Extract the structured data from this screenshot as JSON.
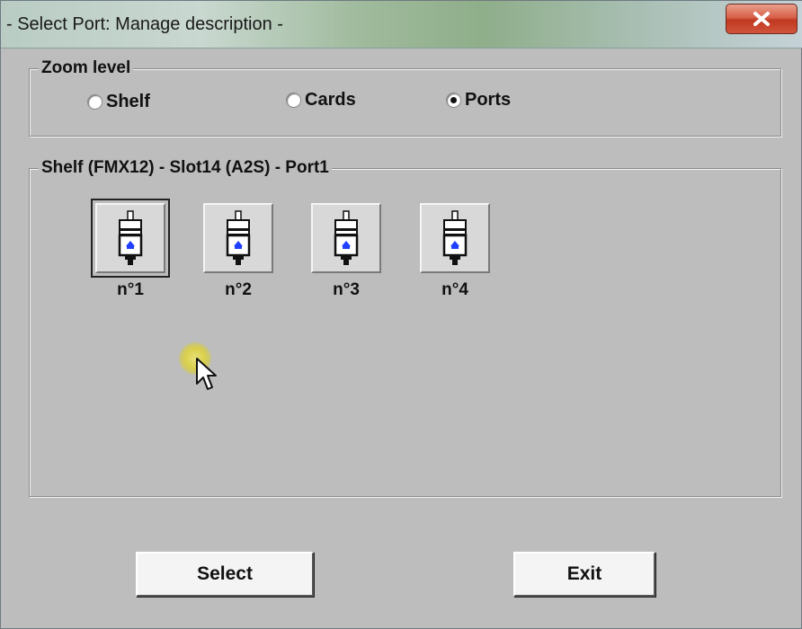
{
  "window": {
    "title": "- Select Port: Manage description -",
    "close_icon": "close-icon"
  },
  "zoom": {
    "legend": "Zoom level",
    "options": [
      {
        "label": "Shelf",
        "checked": false
      },
      {
        "label": "Cards",
        "checked": false
      },
      {
        "label": "Ports",
        "checked": true
      }
    ]
  },
  "ports_group": {
    "legend": "Shelf (FMX12) - Slot14 (A2S) - Port1",
    "ports": [
      {
        "label": "n°1",
        "icon": "port-connector-icon",
        "selected": true
      },
      {
        "label": "n°2",
        "icon": "port-connector-icon",
        "selected": false
      },
      {
        "label": "n°3",
        "icon": "port-connector-icon",
        "selected": false
      },
      {
        "label": "n°4",
        "icon": "port-connector-icon",
        "selected": false
      }
    ]
  },
  "buttons": {
    "select_label": "Select",
    "exit_label": "Exit"
  },
  "colors": {
    "window_bg": "#bdbdbd",
    "close_button": "#c0381f",
    "connector_accent": "#1f3fff"
  }
}
